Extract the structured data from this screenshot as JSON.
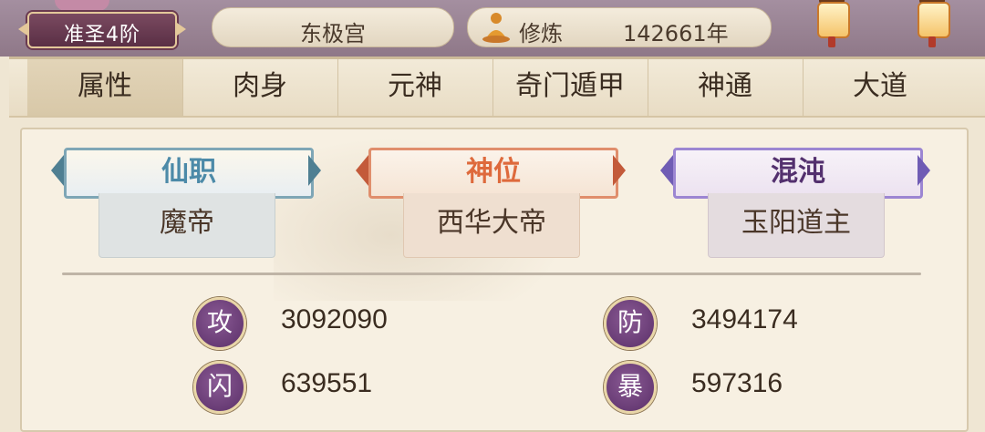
{
  "header": {
    "rank": "准圣4阶",
    "location": "东极宫",
    "cultivation_label": "修炼",
    "cultivation_value": "142661年"
  },
  "tabs": [
    {
      "label": "属性",
      "active": true
    },
    {
      "label": "肉身",
      "active": false
    },
    {
      "label": "元神",
      "active": false
    },
    {
      "label": "奇门遁甲",
      "active": false
    },
    {
      "label": "神通",
      "active": false
    },
    {
      "label": "大道",
      "active": false
    }
  ],
  "titles": [
    {
      "category": "仙职",
      "name": "魔帝",
      "color": "#4c8aa8"
    },
    {
      "category": "神位",
      "name": "西华大帝",
      "color": "#de6a3c"
    },
    {
      "category": "混沌",
      "name": "玉阳道主",
      "color": "#53306e"
    }
  ],
  "stats": [
    {
      "label": "攻",
      "value": "3092090"
    },
    {
      "label": "防",
      "value": "3494174"
    },
    {
      "label": "闪",
      "value": "639551"
    },
    {
      "label": "暴",
      "value": "597316"
    }
  ],
  "icons": {
    "cultivation": "meditating-figure-icon",
    "lantern": "lantern-icon"
  }
}
